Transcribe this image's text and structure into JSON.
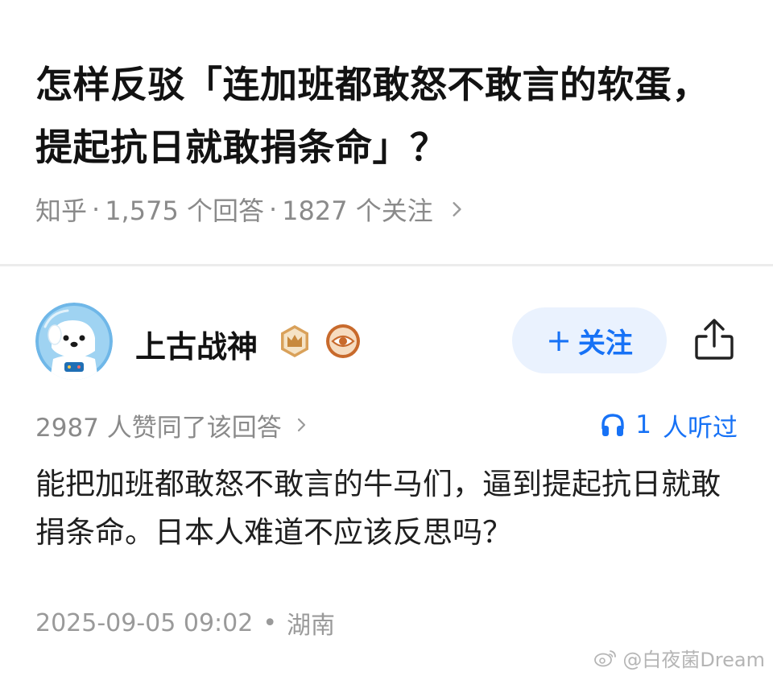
{
  "question": {
    "title": "怎样反驳「连加班都敢怒不敢言的软蛋，提起抗日就敢捐条命」？",
    "source": "知乎",
    "answer_count": "1,575 个回答",
    "follower_count": "1827 个关注"
  },
  "author": {
    "name": "上古战神",
    "avatar_icon": "astronaut-dog-avatar",
    "badges": [
      "crown-badge-icon",
      "eye-badge-icon"
    ]
  },
  "actions": {
    "follow_plus": "+",
    "follow_label": "关注",
    "share_icon": "share-icon"
  },
  "answer": {
    "vote_text": "2987 人赞同了该回答",
    "listen_count": "1",
    "listen_label": "人听过",
    "content": "能把加班都敢怒不敢言的牛马们，逼到提起抗日就敢捐条命。日本人难道不应该反思吗？",
    "date": "2025-09-05 09:02",
    "location": "湖南"
  },
  "watermark": {
    "text": "@白夜菌Dream",
    "icon": "weibo-icon"
  },
  "colors": {
    "accent": "#1772f6",
    "follow_bg": "#eaf2fe",
    "muted": "#8a8a8a",
    "divider": "#ececec"
  }
}
